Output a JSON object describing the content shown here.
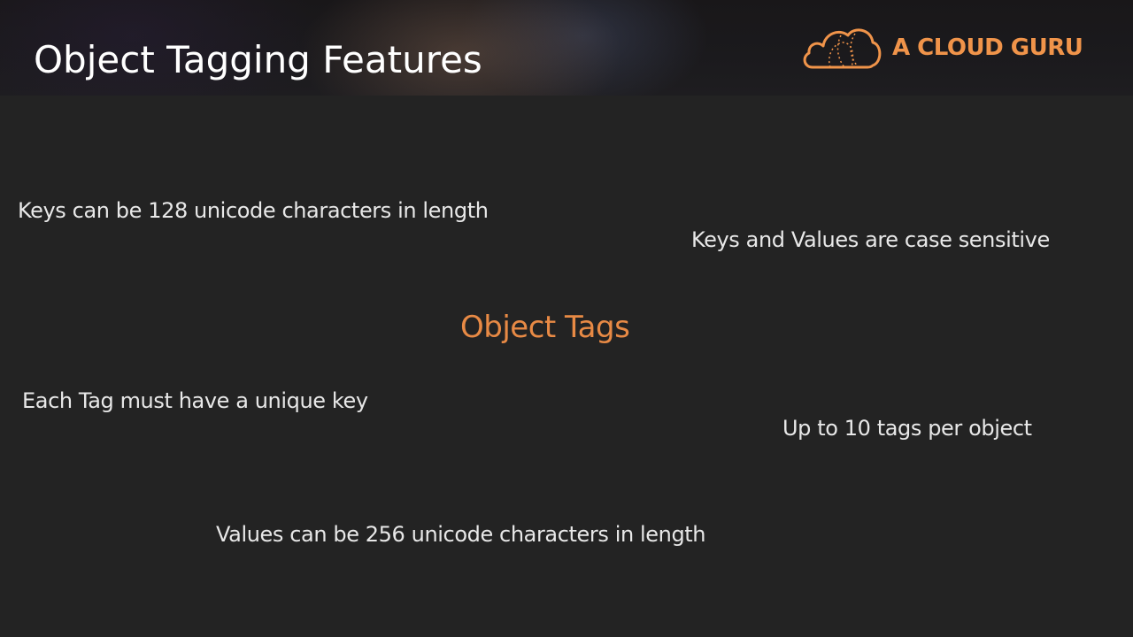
{
  "header": {
    "title": "Object Tagging Features",
    "brand": {
      "name": "A CLOUD GURU",
      "logo_icon": "cloud-logo-icon",
      "color": "#f0944a"
    }
  },
  "main": {
    "center_label": "Object Tags",
    "center_label_color": "#e88a45",
    "facts": [
      "Keys can be 128 unicode characters in length",
      "Keys and Values are case sensitive",
      "Each Tag must have a unique key",
      "Up to 10 tags per object",
      "Values can be 256 unicode characters in length"
    ]
  }
}
